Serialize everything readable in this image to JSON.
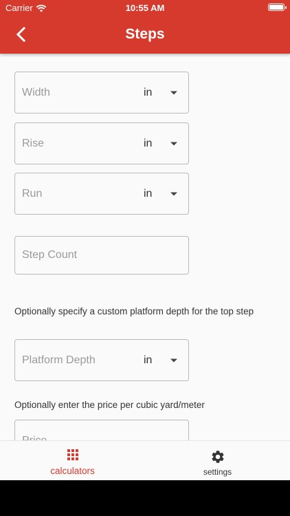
{
  "status_bar": {
    "carrier": "Carrier",
    "time": "10:55 AM"
  },
  "header": {
    "title": "Steps"
  },
  "fields": {
    "width": {
      "placeholder": "Width",
      "unit": "in"
    },
    "rise": {
      "placeholder": "Rise",
      "unit": "in"
    },
    "run": {
      "placeholder": "Run",
      "unit": "in"
    },
    "step_count": {
      "placeholder": "Step Count"
    },
    "platform_depth": {
      "placeholder": "Platform Depth",
      "unit": "in"
    },
    "price": {
      "placeholder": "Price"
    }
  },
  "hints": {
    "platform": "Optionally specify a custom platform depth for the top step",
    "price": "Optionally enter the price per cubic yard/meter"
  },
  "bottom_nav": {
    "calculators_label": "calculators",
    "settings_label": "settings"
  },
  "colors": {
    "accent": "#d63a2c",
    "background": "#fafafa"
  }
}
